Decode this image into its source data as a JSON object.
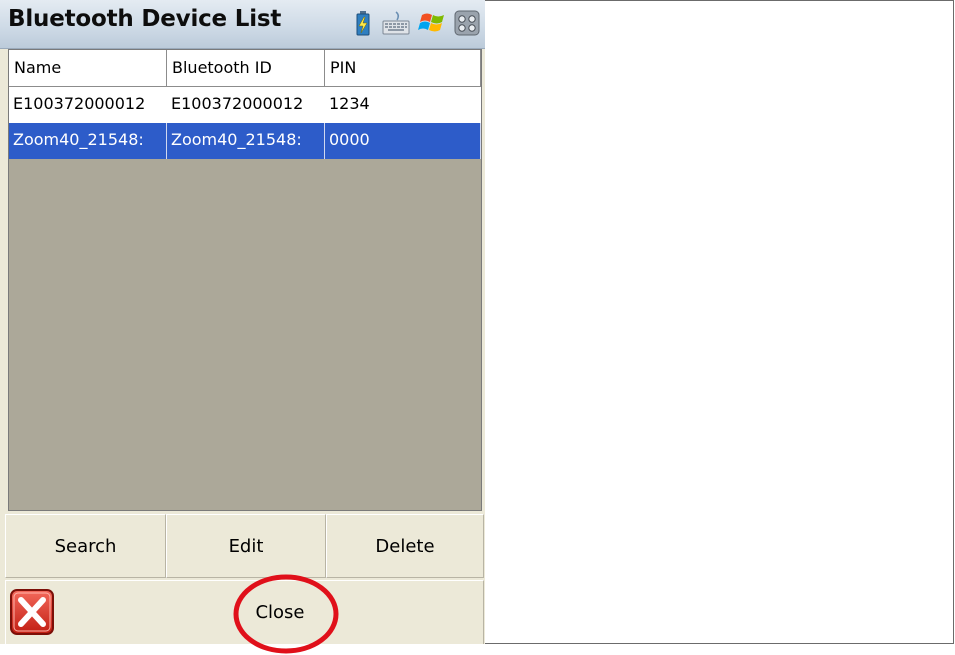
{
  "window": {
    "title": "Bluetooth Device List",
    "tray_icons": [
      "battery-charging-icon",
      "keyboard-icon",
      "windows-start-icon",
      "connectivity-icon"
    ]
  },
  "list": {
    "columns": [
      "Name",
      "Bluetooth ID",
      "PIN"
    ],
    "rows": [
      {
        "name": "E100372000012",
        "bluetooth_id": "E100372000012",
        "pin": "1234",
        "selected": false
      },
      {
        "name": "Zoom40_21548:",
        "bluetooth_id": "Zoom40_21548:",
        "pin": "0000",
        "selected": true
      }
    ],
    "selection_color": "#2d5cc9"
  },
  "buttons": {
    "search": "Search",
    "edit": "Edit",
    "delete": "Delete",
    "close": "Close"
  },
  "annotation": {
    "highlight_color": "#e0101a",
    "highlight_target": "close-button"
  }
}
